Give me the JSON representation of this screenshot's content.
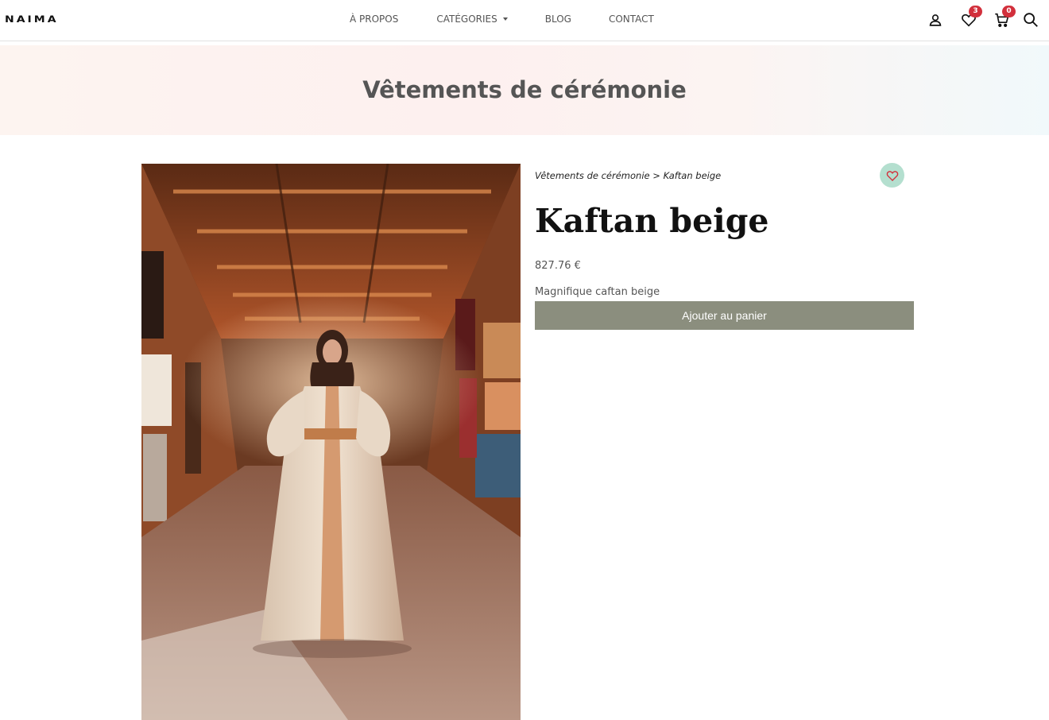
{
  "header": {
    "logo": "NAIMA",
    "nav": [
      {
        "label": "À PROPOS",
        "dropdown": false
      },
      {
        "label": "CATÉGORIES",
        "dropdown": true
      },
      {
        "label": "BLOG",
        "dropdown": false
      },
      {
        "label": "CONTACT",
        "dropdown": false
      }
    ],
    "icons": {
      "account": "user-icon",
      "wishlist": "heart-icon",
      "wishlist_count": "3",
      "cart": "cart-icon",
      "cart_count": "0",
      "search": "search-icon"
    }
  },
  "banner": {
    "title": "Vêtements de cérémonie"
  },
  "breadcrumb": {
    "category": "Vêtements de cérémonie",
    "separator": ">",
    "current": "Kaftan beige"
  },
  "product": {
    "title": "Kaftan beige",
    "price": "827.76 €",
    "description": "Magnifique caftan beige",
    "add_to_cart_label": "Ajouter au panier",
    "image": "kaftan-photo"
  },
  "colors": {
    "accent_badge": "#d2303c",
    "button": "#8b8e7e",
    "favorite_bg": "#b4dfcf"
  }
}
